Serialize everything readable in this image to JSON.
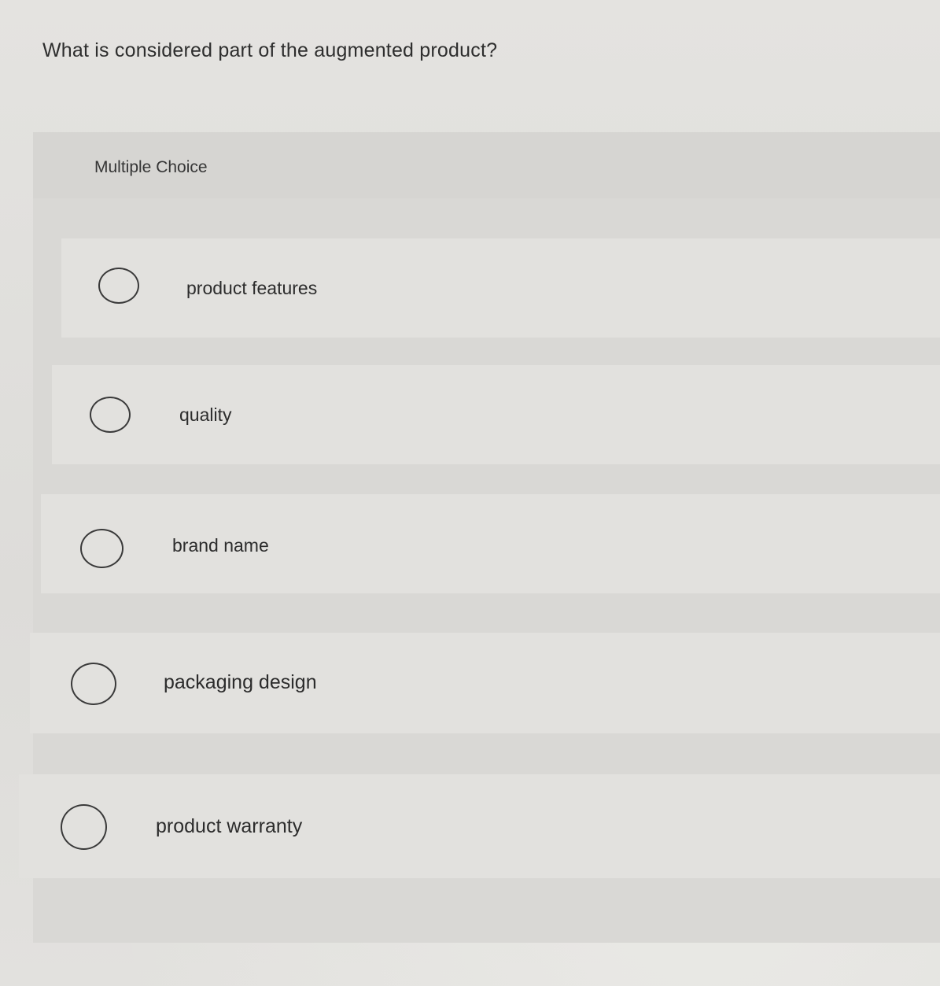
{
  "question": {
    "text": "What is considered part of the augmented product?"
  },
  "answer_panel": {
    "type_label": "Multiple Choice",
    "options": [
      {
        "label": "product features"
      },
      {
        "label": "quality"
      },
      {
        "label": "brand name"
      },
      {
        "label": "packaging design"
      },
      {
        "label": "product warranty"
      }
    ]
  }
}
